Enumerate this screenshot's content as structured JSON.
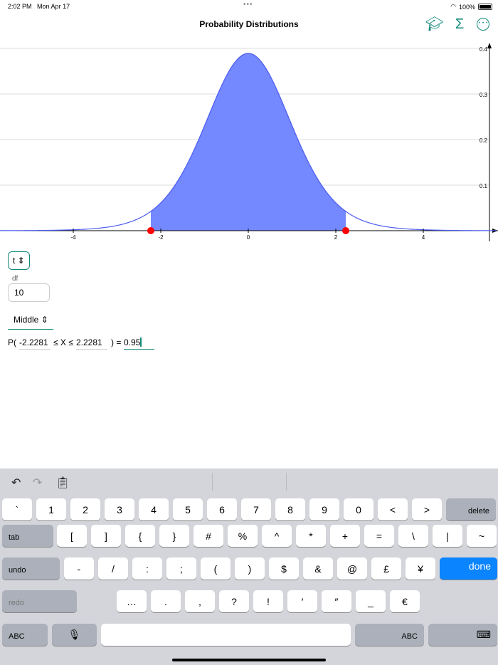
{
  "status": {
    "time": "2:02 PM",
    "date": "Mon Apr 17",
    "battery": "100%"
  },
  "header": {
    "title": "Probability Distributions",
    "icons": [
      "graduation-cap-icon",
      "sigma-icon",
      "more-icon"
    ]
  },
  "chart_data": {
    "type": "area",
    "distribution": "t",
    "df": 10,
    "shaded_from": -2.2281,
    "shaded_to": 2.2281,
    "xlim": [
      -5.67,
      5.7
    ],
    "ylim": [
      0,
      0.4
    ],
    "xticks": [
      -4,
      -2,
      0,
      2,
      4
    ],
    "yticks": [
      0.1,
      0.2,
      0.3,
      0.4
    ],
    "fill": "#7488ff",
    "line": "#4c5cf0",
    "marker_color": "#ff0000"
  },
  "controls": {
    "distribution": "t",
    "df_label": "df",
    "df_value": "10",
    "region": "Middle",
    "p_prefix": "P(",
    "lower": "-2.2281",
    "mid_text": "≤ X ≤",
    "upper": "2.2281",
    "p_suffix": ") =",
    "prob": "0.95"
  },
  "keyboard": {
    "rows": [
      [
        "`",
        "1",
        "2",
        "3",
        "4",
        "5",
        "6",
        "7",
        "8",
        "9",
        "0",
        "<",
        ">",
        "delete"
      ],
      [
        "tab",
        "[",
        "]",
        "{",
        "}",
        "#",
        "%",
        "^",
        "*",
        "+",
        "=",
        "\\",
        "|",
        "~"
      ],
      [
        "undo",
        "-",
        "/",
        ":",
        ";",
        "(",
        ")",
        "$",
        "&",
        "@",
        "£",
        "¥",
        "done"
      ],
      [
        "redo",
        "…",
        ".",
        ",",
        "?",
        "!",
        "′",
        "″",
        "_",
        "€"
      ],
      [
        "ABC",
        "🎙",
        "",
        "ABC",
        "⌨"
      ]
    ]
  }
}
